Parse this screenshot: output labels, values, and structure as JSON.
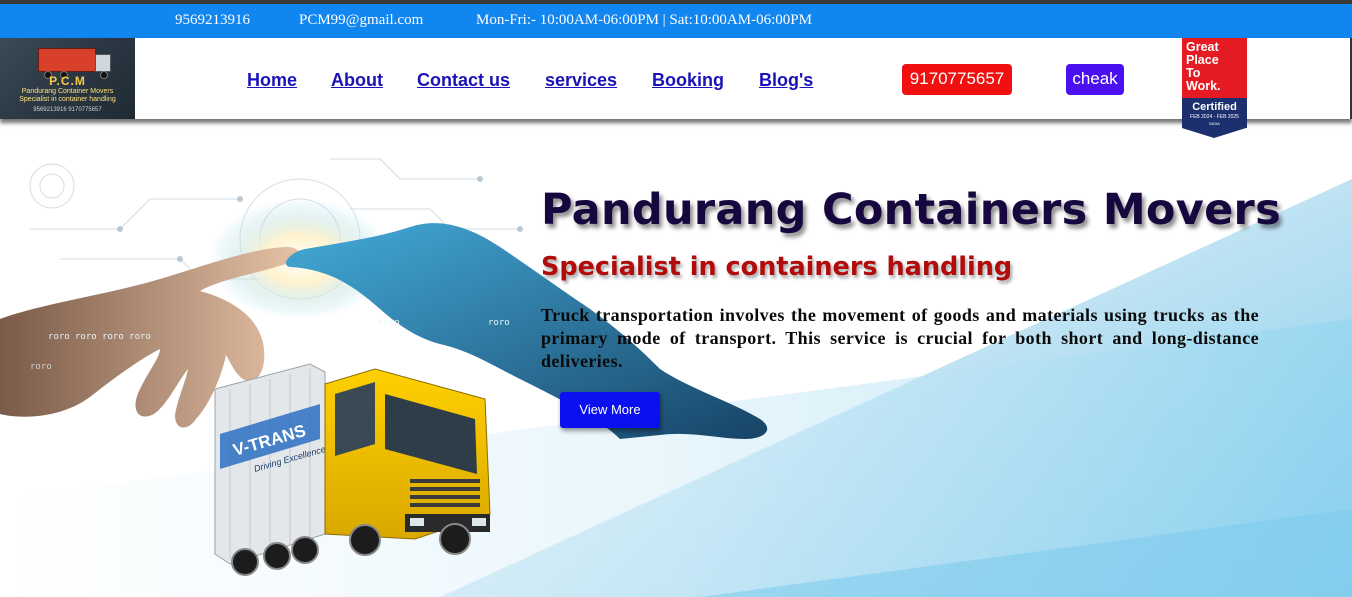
{
  "topbar": {
    "phone": "9569213916",
    "email": "PCM99@gmail.com",
    "hours": "Mon-Fri:- 10:00AM-06:00PM | Sat:10:00AM-06:00PM"
  },
  "logo": {
    "brand": "P.C.M",
    "tagline_1": "Pandurang Container Movers",
    "tagline_2": "Specialist in container handling",
    "tagline_3": "9569213916 9170775657"
  },
  "nav": {
    "home": "Home",
    "about": "About",
    "contact": "Contact us",
    "services": "services",
    "booking": "Booking",
    "blogs": "Blog's"
  },
  "phone_button": "9170775657",
  "cheak_button": "cheak",
  "badge": {
    "line1": "Great",
    "line2": "Place",
    "line3": "To",
    "line4": "Work.",
    "certified": "Certified",
    "dates": "FEB 2024 - FEB 2025",
    "country": "INDIA"
  },
  "hero": {
    "title": "Pandurang Containers Movers",
    "subtitle": "Specialist in containers handling",
    "description": "Truck transportation involves the movement of goods and materials using trucks as the primary mode of transport. This service is crucial for both short and long-distance deliveries.",
    "cta": "View More",
    "truck_brand": "V-TRANS",
    "truck_slogan": "Driving Excellence"
  },
  "colors": {
    "topbar": "#1185f0",
    "nav_link": "#1a13b8",
    "phone_button": "#f01010",
    "cheak_button": "#4a10f0",
    "cta": "#0a10ee",
    "title": "#16073e",
    "subtitle": "#b10b0b"
  }
}
